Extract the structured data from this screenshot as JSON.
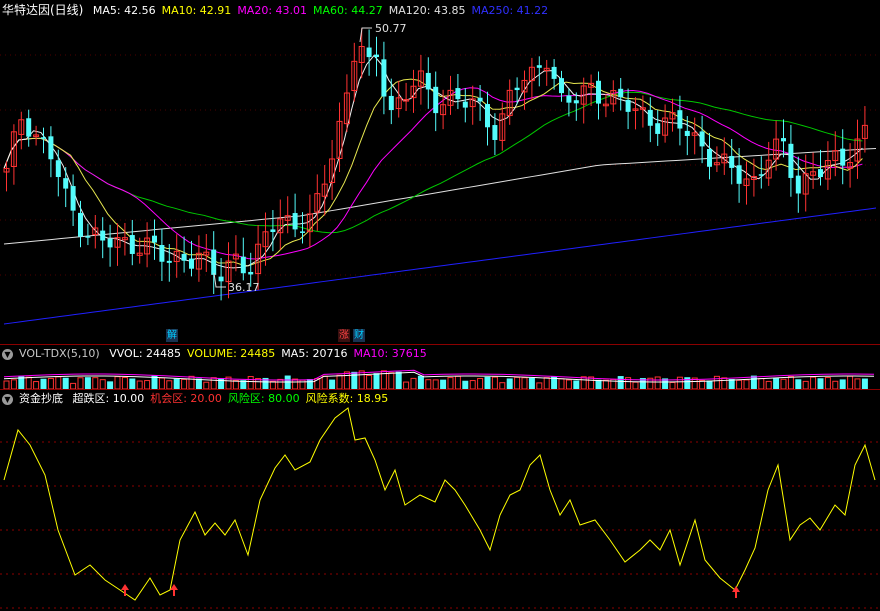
{
  "main": {
    "title": "华特达因(日线)",
    "ma": [
      {
        "label": "MA5: 42.56",
        "color": "#ffffff"
      },
      {
        "label": "MA10: 42.91",
        "color": "#ffff00"
      },
      {
        "label": "MA20: 43.01",
        "color": "#ff00ff"
      },
      {
        "label": "MA60: 44.27",
        "color": "#00ff00"
      },
      {
        "label": "MA120: 43.85",
        "color": "#e0e0e0"
      },
      {
        "label": "MA250: 41.22",
        "color": "#3030ff"
      }
    ],
    "high_label": "50.77",
    "low_label": "36.17",
    "tags": [
      {
        "text": "解",
        "color": "#00ccff",
        "bg": "#1a3350"
      },
      {
        "text": "涨",
        "color": "#ff4444",
        "bg": "#3a1010"
      },
      {
        "text": "财",
        "color": "#00ccff",
        "bg": "#1a3350"
      }
    ],
    "colors": {
      "up": "#ff3232",
      "down": "#54fcfc",
      "ma250": "#2020ff",
      "ma120": "#e0e0e0",
      "ma60": "#00c800",
      "ma20": "#ff00ff",
      "ma10": "#ffff00",
      "ma5": "#ffffff"
    }
  },
  "volume": {
    "title": "VOL-TDX(5,10)",
    "items": [
      {
        "label": "VVOL: 24485",
        "color": "#ffffff"
      },
      {
        "label": "VOLUME: 24485",
        "color": "#ffff00"
      },
      {
        "label": "MA5: 20716",
        "color": "#ffffff"
      },
      {
        "label": "MA10: 37615",
        "color": "#ff00ff"
      }
    ]
  },
  "indicator": {
    "title": "资金抄底",
    "items": [
      {
        "label": "超跌区: 10.00",
        "color": "#ffffff"
      },
      {
        "label": "机会区: 20.00",
        "color": "#ff3232"
      },
      {
        "label": "风险区: 80.00",
        "color": "#00ff00"
      },
      {
        "label": "风险系数: 18.95",
        "color": "#ffff00"
      }
    ],
    "line_color": "#ffff00",
    "dot_color": "#ff3232"
  }
}
